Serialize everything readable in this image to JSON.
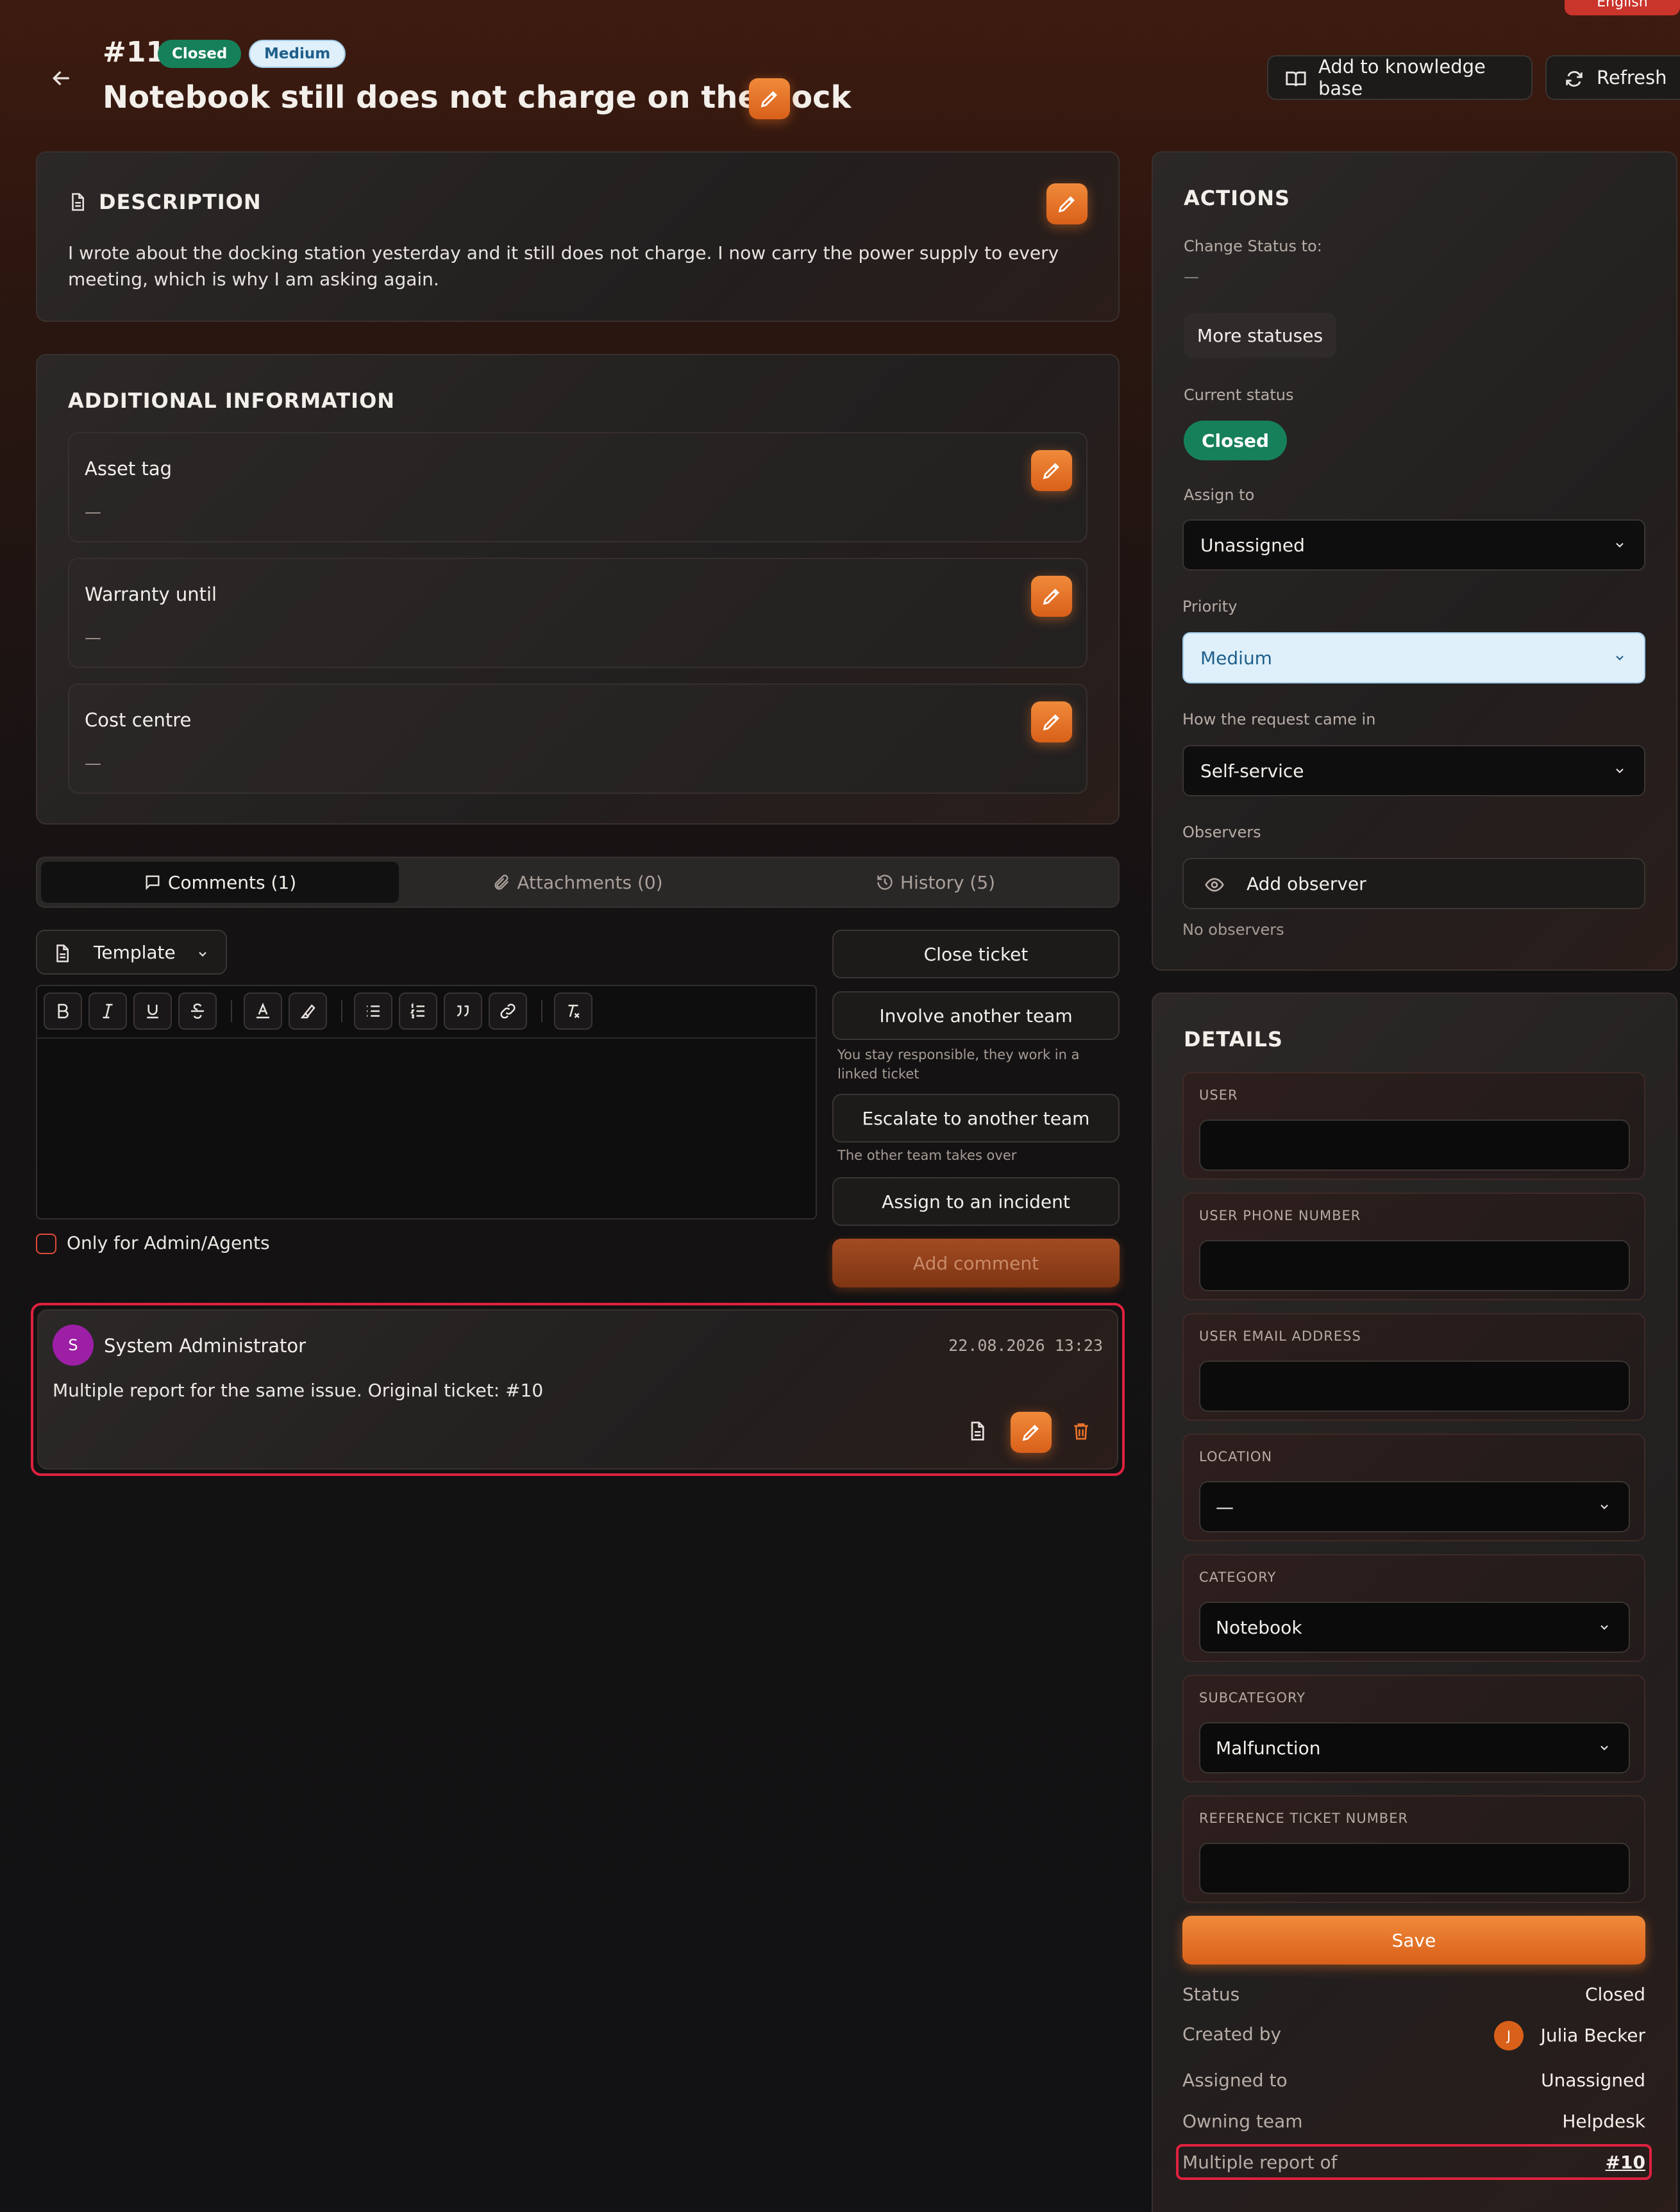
{
  "header": {
    "language": "English",
    "ticket_number": "#11",
    "status_badge": "Closed",
    "priority_badge": "Medium",
    "title": "Notebook still does not charge on the dock",
    "add_kb_label": "Add to knowledge base",
    "refresh_label": "Refresh"
  },
  "description": {
    "heading": "DESCRIPTION",
    "text": "I wrote about the docking station yesterday and it still does not charge. I now carry the power supply to every meeting, which is why I am asking again."
  },
  "additional": {
    "heading": "ADDITIONAL INFORMATION",
    "fields": [
      {
        "label": "Asset tag",
        "value": "—"
      },
      {
        "label": "Warranty until",
        "value": "—"
      },
      {
        "label": "Cost centre",
        "value": "—"
      }
    ]
  },
  "tabs": [
    {
      "label": "Comments (1)",
      "icon": "comment-icon",
      "active": true
    },
    {
      "label": "Attachments (0)",
      "icon": "paperclip-icon",
      "active": false
    },
    {
      "label": "History (5)",
      "icon": "history-icon",
      "active": false
    }
  ],
  "editor": {
    "template_label": "Template",
    "only_admin_label": "Only for Admin/Agents"
  },
  "side_buttons": {
    "close_ticket": "Close ticket",
    "involve_team": "Involve another team",
    "involve_hint": "You stay responsible, they work in a linked ticket",
    "escalate_team": "Escalate to another team",
    "escalate_hint": "The other team takes over",
    "assign_incident": "Assign to an incident",
    "add_comment": "Add comment"
  },
  "comment": {
    "avatar_letter": "S",
    "author": "System Administrator",
    "timestamp": "22.08.2026 13:23",
    "text": "Multiple report for the same issue. Original ticket: #10"
  },
  "actions": {
    "heading": "ACTIONS",
    "change_status_label": "Change Status to:",
    "change_status_value": "—",
    "more_statuses": "More statuses",
    "current_status_label": "Current status",
    "current_status": "Closed",
    "assign_to_label": "Assign to",
    "assign_to_value": "Unassigned",
    "priority_label": "Priority",
    "priority_value": "Medium",
    "came_in_label": "How the request came in",
    "came_in_value": "Self-service",
    "observers_label": "Observers",
    "add_observer": "Add observer",
    "no_observers": "No observers"
  },
  "details": {
    "heading": "DETAILS",
    "fields": [
      {
        "label": "USER",
        "value": ""
      },
      {
        "label": "USER PHONE NUMBER",
        "value": ""
      },
      {
        "label": "USER EMAIL ADDRESS",
        "value": ""
      },
      {
        "label": "LOCATION",
        "value": "—"
      },
      {
        "label": "CATEGORY",
        "value": "Notebook"
      },
      {
        "label": "SUBCATEGORY",
        "value": "Malfunction"
      },
      {
        "label": "REFERENCE TICKET NUMBER",
        "value": ""
      }
    ],
    "save_label": "Save",
    "summary": {
      "status_label": "Status",
      "status_value": "Closed",
      "created_by_label": "Created by",
      "created_by_avatar": "J",
      "created_by_value": "Julia Becker",
      "assigned_label": "Assigned to",
      "assigned_value": "Unassigned",
      "team_label": "Owning team",
      "team_value": "Helpdesk",
      "multiple_label": "Multiple report of",
      "multiple_value": "#10"
    }
  },
  "colors": {
    "accent": "#e8722a",
    "status_closed": "#16805a",
    "priority_medium_bg": "#dff0fb",
    "highlight": "#e0213f"
  }
}
